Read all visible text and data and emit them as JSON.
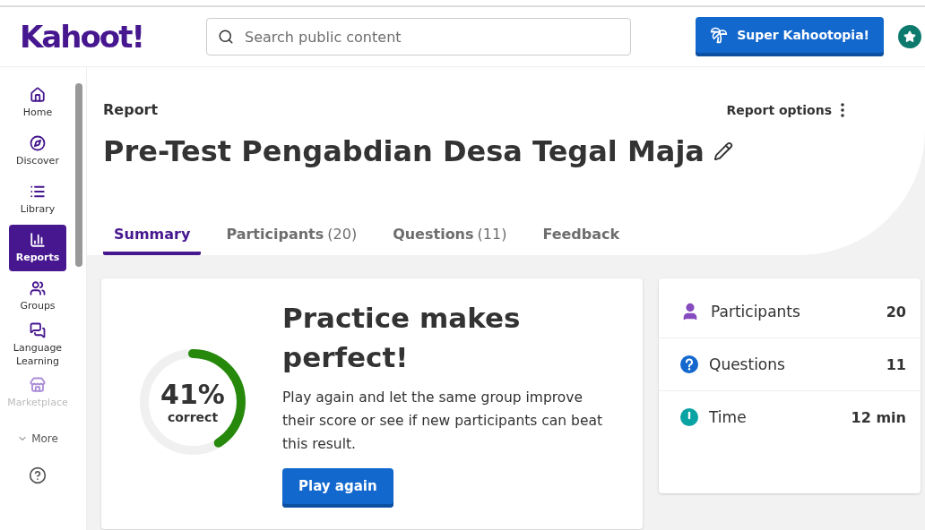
{
  "header": {
    "logo": "Kahoot!",
    "search": {
      "placeholder": "Search public content"
    },
    "upgrade_button": "Super Kahootopia!"
  },
  "sidebar": {
    "items": [
      {
        "kind": "home",
        "label": "Home",
        "selected": false,
        "faded": false
      },
      {
        "kind": "discover",
        "label": "Discover",
        "selected": false,
        "faded": false
      },
      {
        "kind": "library",
        "label": "Library",
        "selected": false,
        "faded": false
      },
      {
        "kind": "reports",
        "label": "Reports",
        "selected": true,
        "faded": false
      },
      {
        "kind": "groups",
        "label": "Groups",
        "selected": false,
        "faded": false
      },
      {
        "kind": "language",
        "label": "Language Learning",
        "selected": false,
        "faded": false
      },
      {
        "kind": "marketplace",
        "label": "Marketplace",
        "selected": false,
        "faded": true
      }
    ],
    "more": "More"
  },
  "report": {
    "breadcrumb": "Report",
    "options": "Report options",
    "title": "Pre-Test Pengabdian Desa Tegal Maja",
    "tabs": [
      {
        "label": "Summary",
        "selected": true
      },
      {
        "label": "Participants",
        "count": "(20)",
        "selected": false
      },
      {
        "label": "Questions",
        "count": "(11)",
        "selected": false
      },
      {
        "label": "Feedback",
        "selected": false
      }
    ]
  },
  "summary": {
    "percent": "41%",
    "percent_caption": "correct",
    "level": 0.41,
    "heading": "Practice makes perfect!",
    "body": "Play again and let the same group improve their score or see if new participants can beat this result.",
    "button": "Play again"
  },
  "stats": [
    {
      "kind": "person",
      "label": "Participants",
      "value": "20",
      "color": "#864cbf"
    },
    {
      "kind": "question",
      "label": "Questions",
      "value": "11",
      "color": "#1368ce"
    },
    {
      "kind": "time",
      "label": "Time",
      "value": "12 min",
      "color": "#0aa3a3"
    }
  ]
}
